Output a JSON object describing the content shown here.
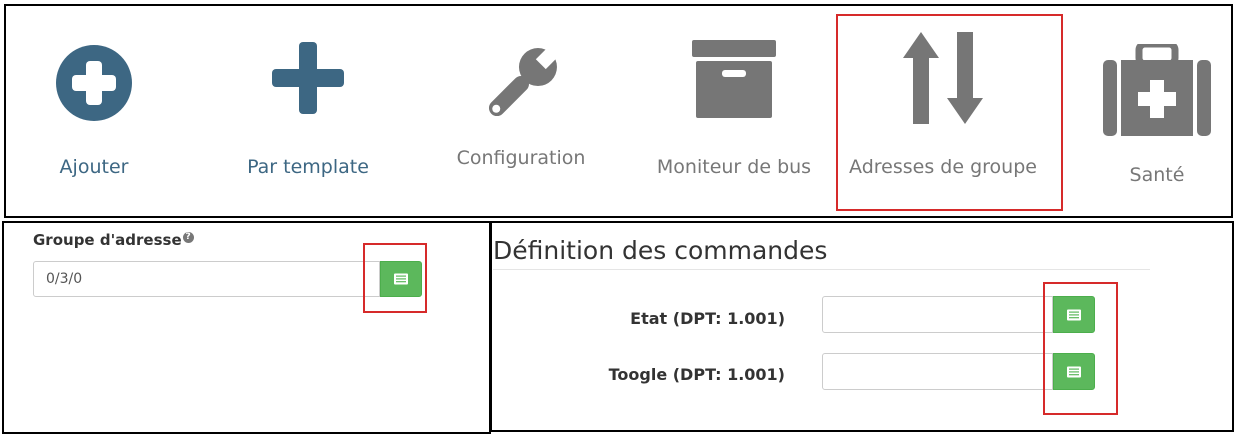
{
  "toolbar": {
    "items": [
      {
        "label": "Ajouter",
        "icon": "plus-circle-icon"
      },
      {
        "label": "Par template",
        "icon": "plus-icon"
      },
      {
        "label": "Configuration",
        "icon": "wrench-icon"
      },
      {
        "label": "Moniteur de bus",
        "icon": "archive-icon"
      },
      {
        "label": "Adresses de groupe",
        "icon": "arrows-up-down-icon"
      },
      {
        "label": "Santé",
        "icon": "medkit-icon"
      }
    ]
  },
  "group_address": {
    "label": "Groupe d'adresse",
    "help": "?",
    "value": "0/3/0",
    "button_icon": "list-icon"
  },
  "commands": {
    "title": "Définition des commandes",
    "rows": [
      {
        "label": "Etat (DPT: 1.001)",
        "value": "",
        "button_icon": "list-icon"
      },
      {
        "label": "Toogle (DPT: 1.001)",
        "value": "",
        "button_icon": "list-icon"
      }
    ]
  },
  "colors": {
    "accent_blue": "#3d6783",
    "icon_gray": "#767676",
    "button_green": "#5cb85c",
    "highlight_red": "#d62a2a"
  }
}
